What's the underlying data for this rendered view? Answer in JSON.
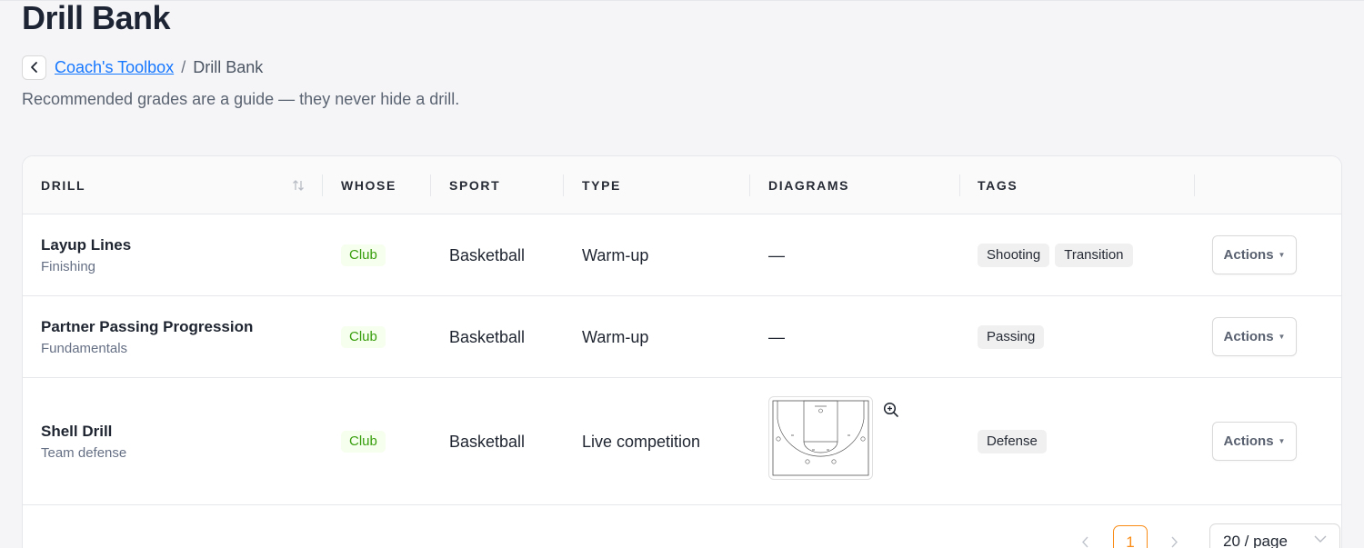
{
  "page": {
    "title": "Drill Bank",
    "breadcrumb": {
      "parent": "Coach's Toolbox",
      "separator": "/",
      "current": "Drill Bank"
    },
    "subtitle": "Recommended grades are a guide — they never hide a drill."
  },
  "table": {
    "columns": [
      "DRILL",
      "WHOSE",
      "SPORT",
      "TYPE",
      "DIAGRAMS",
      "TAGS"
    ],
    "rows": [
      {
        "name": "Layup Lines",
        "category": "Finishing",
        "whose": "Club",
        "sport": "Basketball",
        "type": "Warm-up",
        "diagrams": "—",
        "tags": [
          "Shooting",
          "Transition"
        ],
        "action": "Actions"
      },
      {
        "name": "Partner Passing Progression",
        "category": "Fundamentals",
        "whose": "Club",
        "sport": "Basketball",
        "type": "Warm-up",
        "diagrams": "—",
        "tags": [
          "Passing"
        ],
        "action": "Actions"
      },
      {
        "name": "Shell Drill",
        "category": "Team defense",
        "whose": "Club",
        "sport": "Basketball",
        "type": "Live competition",
        "diagrams": "",
        "tags": [
          "Defense"
        ],
        "action": "Actions"
      }
    ]
  },
  "pagination": {
    "current_page": "1",
    "page_size": "20 / page"
  },
  "colors": {
    "accent": "#fa8c16",
    "link": "#1677ff",
    "club_tag_text": "#389e0d",
    "club_tag_bg": "#f6ffed"
  },
  "icons": [
    "chevron-left-icon",
    "sort-icon",
    "zoom-in-icon",
    "caret-down-icon",
    "chevron-down-icon"
  ]
}
